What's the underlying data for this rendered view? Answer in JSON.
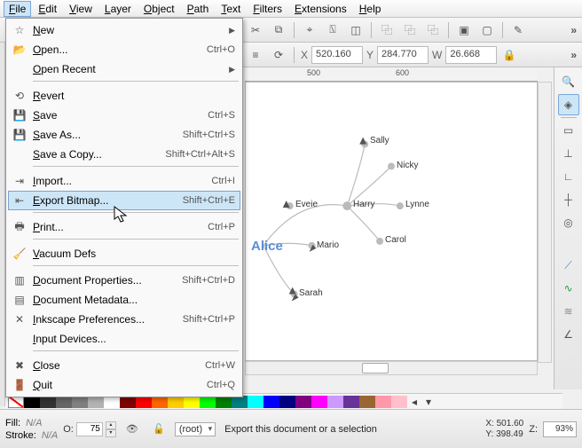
{
  "menubar": [
    "File",
    "Edit",
    "View",
    "Layer",
    "Object",
    "Path",
    "Text",
    "Filters",
    "Extensions",
    "Help"
  ],
  "file_menu": [
    {
      "icon": "☆",
      "label": "New",
      "submenu": true
    },
    {
      "icon": "📂",
      "label": "Open...",
      "accel": "Ctrl+O"
    },
    {
      "icon": "",
      "label": "Open Recent",
      "submenu": true
    },
    {
      "sep": true
    },
    {
      "icon": "⟲",
      "label": "Revert"
    },
    {
      "icon": "💾",
      "label": "Save",
      "accel": "Ctrl+S"
    },
    {
      "icon": "💾",
      "label": "Save As...",
      "accel": "Shift+Ctrl+S"
    },
    {
      "icon": "",
      "label": "Save a Copy...",
      "accel": "Shift+Ctrl+Alt+S"
    },
    {
      "sep": true
    },
    {
      "icon": "⇥",
      "label": "Import...",
      "accel": "Ctrl+I"
    },
    {
      "icon": "⇤",
      "label": "Export Bitmap...",
      "accel": "Shift+Ctrl+E",
      "highlight": true
    },
    {
      "sep": true
    },
    {
      "icon": "🖶",
      "label": "Print...",
      "accel": "Ctrl+P"
    },
    {
      "sep": true
    },
    {
      "icon": "🧹",
      "label": "Vacuum Defs"
    },
    {
      "sep": true
    },
    {
      "icon": "▥",
      "label": "Document Properties...",
      "accel": "Shift+Ctrl+D"
    },
    {
      "icon": "▤",
      "label": "Document Metadata..."
    },
    {
      "icon": "✕",
      "label": "Inkscape Preferences...",
      "accel": "Shift+Ctrl+P"
    },
    {
      "icon": "",
      "label": "Input Devices..."
    },
    {
      "sep": true
    },
    {
      "icon": "✖",
      "label": "Close",
      "accel": "Ctrl+W"
    },
    {
      "icon": "🚪",
      "label": "Quit",
      "accel": "Ctrl+Q"
    }
  ],
  "tooloptions": {
    "x_label": "X",
    "x": "520.160",
    "y_label": "Y",
    "y": "284.770",
    "w_label": "W",
    "w": "26.668"
  },
  "ruler_ticks": [
    {
      "pos": 70,
      "label": "500"
    },
    {
      "pos": 170,
      "label": "600"
    }
  ],
  "graph_nodes": {
    "alice": "Alice",
    "harry": "Harry",
    "eveie": "Eveie",
    "mario": "Mario",
    "sarah": "Sarah",
    "sally": "Sally",
    "nicky": "Nicky",
    "lynne": "Lynne",
    "carol": "Carol"
  },
  "swatch_colors": [
    "#000000",
    "#333333",
    "#666666",
    "#808080",
    "#b3b3b3",
    "#ffffff",
    "#800000",
    "#ff0000",
    "#ff6600",
    "#ffcc00",
    "#ffff00",
    "#00ff00",
    "#008000",
    "#008080",
    "#00ffff",
    "#0000ff",
    "#000080",
    "#800080",
    "#ff00ff",
    "#cc99ff",
    "#663399",
    "#996633",
    "#ff99aa",
    "#ffc0cb"
  ],
  "status": {
    "fill_label": "Fill:",
    "fill_val": "N/A",
    "stroke_label": "Stroke:",
    "stroke_val": "N/A",
    "opacity_label": "O:",
    "opacity_val": "75",
    "layer": "(root)",
    "message": "Export this document or a selection",
    "x_label": "X:",
    "x": "501.60",
    "y_label": "Y:",
    "y": "398.49",
    "z_label": "Z:",
    "zoom": "93%"
  },
  "chart_data": {
    "type": "network",
    "title": "",
    "nodes": [
      "Alice",
      "Harry",
      "Eveie",
      "Mario",
      "Sarah",
      "Sally",
      "Nicky",
      "Lynne",
      "Carol"
    ],
    "edges": [
      [
        "Alice",
        "Harry"
      ],
      [
        "Alice",
        "Eveie"
      ],
      [
        "Alice",
        "Mario"
      ],
      [
        "Alice",
        "Sarah"
      ],
      [
        "Harry",
        "Sally"
      ],
      [
        "Harry",
        "Nicky"
      ],
      [
        "Harry",
        "Lynne"
      ],
      [
        "Harry",
        "Carol"
      ]
    ]
  }
}
